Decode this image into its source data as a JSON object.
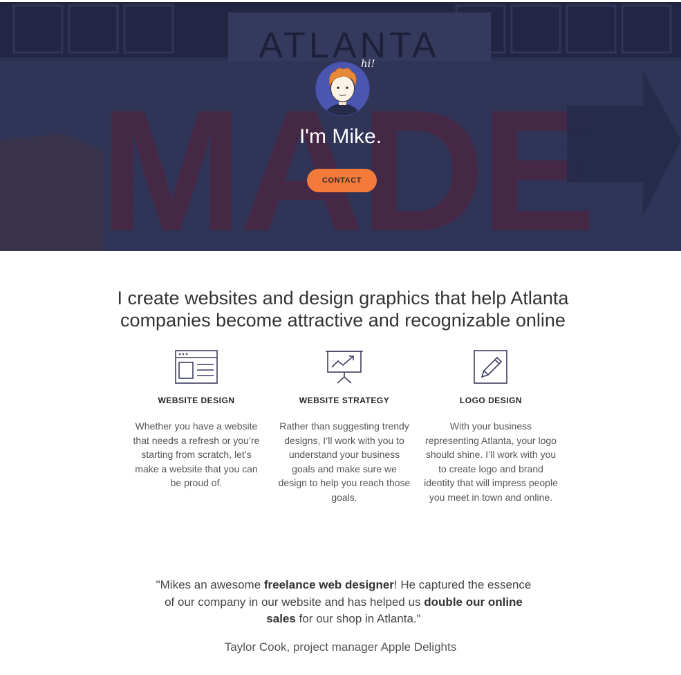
{
  "hero": {
    "greeting_bubble": "hi!",
    "title": "I'm Mike.",
    "contact_label": "CONTACT",
    "background_sign_top": "ATLANTA",
    "background_sign_main": "MADE",
    "accent_color": "#f47a3a"
  },
  "intro": {
    "headline": "I create websites and design graphics that help Atlanta companies become attractive and recognizable online"
  },
  "services": [
    {
      "icon": "browser-window-icon",
      "title": "WEBSITE DESIGN",
      "text": "Whether you have a website that needs a refresh or you’re starting from scratch, let’s make a website that you can be proud of."
    },
    {
      "icon": "presentation-chart-icon",
      "title": "WEBSITE STRATEGY",
      "text": "Rather than suggesting trendy designs, I’ll work with you to understand your business goals and make sure we design to help you reach those goals."
    },
    {
      "icon": "pencil-edit-icon",
      "title": "LOGO DESIGN",
      "text": "With your business representing Atlanta, your logo should shine. I’ll work with you to create logo and brand identity that will impress people you meet in town and online."
    }
  ],
  "testimonial": {
    "part1": "\"Mikes an awesome ",
    "bold1": "freelance web designer",
    "part2": "! He captured the essence of our company in our website and has helped us ",
    "bold2": "double our online sales",
    "part3": " for our shop in Atlanta.\"",
    "author": "Taylor Cook, project manager Apple Delights"
  }
}
